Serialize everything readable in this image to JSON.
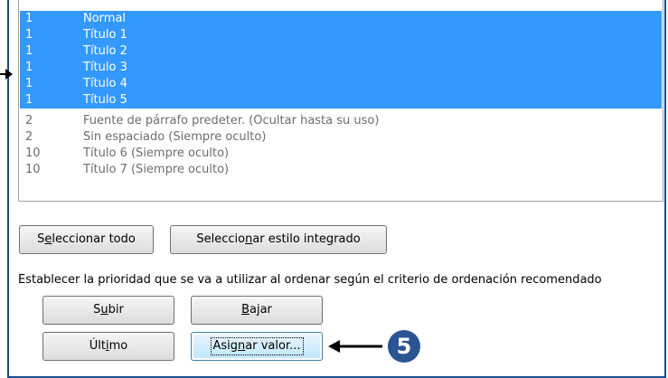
{
  "styles_list": {
    "rows": [
      {
        "priority": "1",
        "name": "Normal",
        "selected": true
      },
      {
        "priority": "1",
        "name": "Título 1",
        "selected": true
      },
      {
        "priority": "1",
        "name": "Título 2",
        "selected": true
      },
      {
        "priority": "1",
        "name": "Título 3",
        "selected": true
      },
      {
        "priority": "1",
        "name": "Título 4",
        "selected": true
      },
      {
        "priority": "1",
        "name": "Título 5",
        "selected": true
      },
      {
        "priority": "2",
        "name": "Fuente de párrafo predeter.  (Ocultar hasta su uso)",
        "selected": false
      },
      {
        "priority": "2",
        "name": "Sin espaciado  (Siempre oculto)",
        "selected": false
      },
      {
        "priority": "10",
        "name": "Título 6  (Siempre oculto)",
        "selected": false
      },
      {
        "priority": "10",
        "name": "Título 7  (Siempre oculto)",
        "selected": false
      }
    ]
  },
  "buttons": {
    "select_all": {
      "pre": "S",
      "key": "e",
      "post": "leccionar todo"
    },
    "select_builtin": {
      "pre": "Seleccio",
      "key": "n",
      "post": "ar estilo integrado"
    },
    "move_up": {
      "pre": "S",
      "key": "u",
      "post": "bir"
    },
    "move_down": {
      "pre": "",
      "key": "B",
      "post": "ajar"
    },
    "last": {
      "pre": "Últ",
      "key": "i",
      "post": "mo"
    },
    "assign_value": {
      "pre": "Asig",
      "key": "n",
      "post": "ar valor..."
    }
  },
  "priority_description": "Establecer la prioridad que se va a utilizar al ordenar según el criterio de ordenación recomendado",
  "callout": {
    "number": "5"
  },
  "colors": {
    "selection": "#3399ff",
    "frame": "#1c4c8c",
    "badge": "#2b5592"
  },
  "icons": [
    "right-arrow-icon",
    "left-arrow-icon"
  ]
}
